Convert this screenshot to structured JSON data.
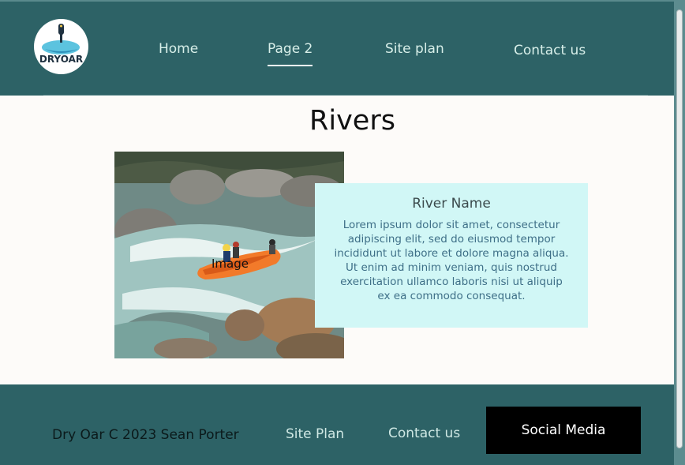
{
  "header": {
    "logo_text": "DRYOAR",
    "nav": [
      {
        "label": "Home"
      },
      {
        "label": "Page 2",
        "active": true
      },
      {
        "label": "Site plan"
      },
      {
        "label": "Contact us"
      }
    ]
  },
  "main": {
    "title": "Rivers",
    "image_label": "Image",
    "card": {
      "title": "River Name",
      "body": "Lorem ipsum dolor sit amet, consectetur adipiscing elit, sed do eiusmod tempor incididunt ut labore et dolore magna aliqua. Ut enim ad minim veniam, quis nostrud exercitation ullamco laboris nisi ut aliquip ex ea commodo consequat."
    }
  },
  "footer": {
    "copyright": "Dry Oar C 2023 Sean Porter",
    "site_plan": "Site Plan",
    "contact": "Contact us",
    "social": "Social Media"
  },
  "colors": {
    "header_bg": "#2d6266",
    "card_bg": "#d1f7f6",
    "social_bg": "#000000"
  }
}
